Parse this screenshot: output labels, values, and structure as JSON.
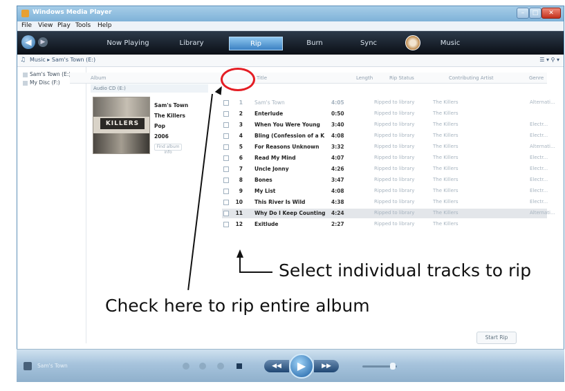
{
  "window": {
    "title": "Windows Media Player",
    "controls": {
      "minimize": "–",
      "maximize": "□",
      "close": "✕"
    }
  },
  "menu": [
    "File",
    "View",
    "Play",
    "Tools",
    "Help"
  ],
  "nav": {
    "tabs": [
      "Now Playing",
      "Library",
      "Rip",
      "Burn",
      "Sync",
      "Music"
    ],
    "active_tab": "Rip"
  },
  "address": {
    "path": "Music ▸ Sam's Town (E:)",
    "right": "☰ ▾  ⚲ ▾"
  },
  "sidebar": [
    "Sam's Town (E:)",
    "My Disc (F:)"
  ],
  "columns": [
    "Album",
    "",
    "Title",
    "Length",
    "Rip Status",
    "Contributing Artist",
    "Genre"
  ],
  "album": {
    "group_label": "Audio CD (E:)",
    "art_text": "KILLERS",
    "title": "Sam's Town",
    "artist": "The Killers",
    "genre": "Pop",
    "year": "2006",
    "find_info": "Find album info"
  },
  "tracks": [
    {
      "num": "1",
      "title": "Sam's Town",
      "length": "4:05",
      "status": "Ripped to library",
      "artist": "The Killers",
      "genre": "Alternati..."
    },
    {
      "num": "2",
      "title": "Enterlude",
      "length": "0:50",
      "status": "Ripped to library",
      "artist": "The Killers",
      "genre": ""
    },
    {
      "num": "3",
      "title": "When You Were Young",
      "length": "3:40",
      "status": "Ripped to library",
      "artist": "The Killers",
      "genre": "Electr..."
    },
    {
      "num": "4",
      "title": "Bling (Confession of a K...",
      "length": "4:08",
      "status": "Ripped to library",
      "artist": "The Killers",
      "genre": "Electr..."
    },
    {
      "num": "5",
      "title": "For Reasons Unknown",
      "length": "3:32",
      "status": "Ripped to library",
      "artist": "The Killers",
      "genre": "Alternati..."
    },
    {
      "num": "6",
      "title": "Read My Mind",
      "length": "4:07",
      "status": "Ripped to library",
      "artist": "The Killers",
      "genre": "Electr..."
    },
    {
      "num": "7",
      "title": "Uncle Jonny",
      "length": "4:26",
      "status": "Ripped to library",
      "artist": "The Killers",
      "genre": "Electr..."
    },
    {
      "num": "8",
      "title": "Bones",
      "length": "3:47",
      "status": "Ripped to library",
      "artist": "The Killers",
      "genre": "Electr..."
    },
    {
      "num": "9",
      "title": "My List",
      "length": "4:08",
      "status": "Ripped to library",
      "artist": "The Killers",
      "genre": "Electr..."
    },
    {
      "num": "10",
      "title": "This River Is Wild",
      "length": "4:38",
      "status": "Ripped to library",
      "artist": "The Killers",
      "genre": "Electr..."
    },
    {
      "num": "11",
      "title": "Why Do I Keep Counting?",
      "length": "4:24",
      "status": "Ripped to library",
      "artist": "The Killers",
      "genre": "Alternati..."
    },
    {
      "num": "12",
      "title": "Exitlude",
      "length": "2:27",
      "status": "Ripped to library",
      "artist": "The Killers",
      "genre": ""
    }
  ],
  "start_rip": "Start Rip",
  "status_bar": "Sam's Town",
  "controls": {
    "prev": "◀◀",
    "play": "▶",
    "next": "▶▶"
  },
  "annotations": {
    "select_tracks": "Select individual tracks to rip",
    "check_album": "Check here to rip entire album"
  },
  "colors": {
    "highlight_circle": "#e41d24",
    "active_tab": "#3b80c2"
  }
}
